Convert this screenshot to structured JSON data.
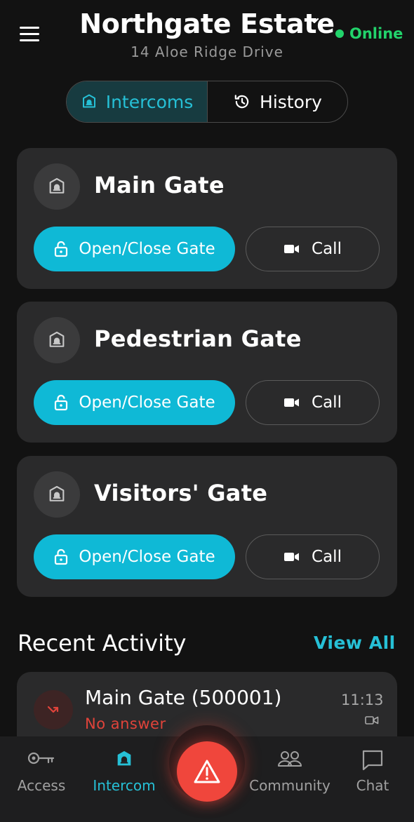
{
  "header": {
    "title": "Northgate Estate",
    "address": "14 Aloe Ridge Drive",
    "status": "Online",
    "status_color": "#22d36b",
    "menu_icon": "hamburger-menu-icon",
    "dropdown_icon": "chevron-down-icon"
  },
  "tabs": [
    {
      "label": "Intercoms",
      "icon": "intercom-bell-icon",
      "active": true
    },
    {
      "label": "History",
      "icon": "history-clock-icon",
      "active": false
    }
  ],
  "gates": [
    {
      "name": "Main Gate",
      "open_label": "Open/Close Gate",
      "call_label": "Call"
    },
    {
      "name": "Pedestrian Gate",
      "open_label": "Open/Close Gate",
      "call_label": "Call"
    },
    {
      "name": "Visitors' Gate",
      "open_label": "Open/Close Gate",
      "call_label": "Call"
    }
  ],
  "recent": {
    "title": "Recent Activity",
    "view_all": "View All",
    "items": [
      {
        "title": "Main Gate (500001)",
        "status": "No answer",
        "time": "11:13",
        "icon": "missed-call-icon",
        "type_icon": "video-icon"
      }
    ]
  },
  "nav": {
    "items": [
      {
        "label": "Access",
        "icon": "key-icon",
        "active": false
      },
      {
        "label": "Intercom",
        "icon": "intercom-bell-icon",
        "active": true
      },
      {
        "label": "Community",
        "icon": "people-icon",
        "active": false
      },
      {
        "label": "Chat",
        "icon": "chat-bubble-icon",
        "active": false
      }
    ],
    "sos_icon": "warning-triangle-icon"
  },
  "colors": {
    "accent": "#0fb9d6",
    "accent_text": "#26c0d6",
    "danger": "#f0463c",
    "background": "#121212",
    "card": "#2a2a2b"
  }
}
